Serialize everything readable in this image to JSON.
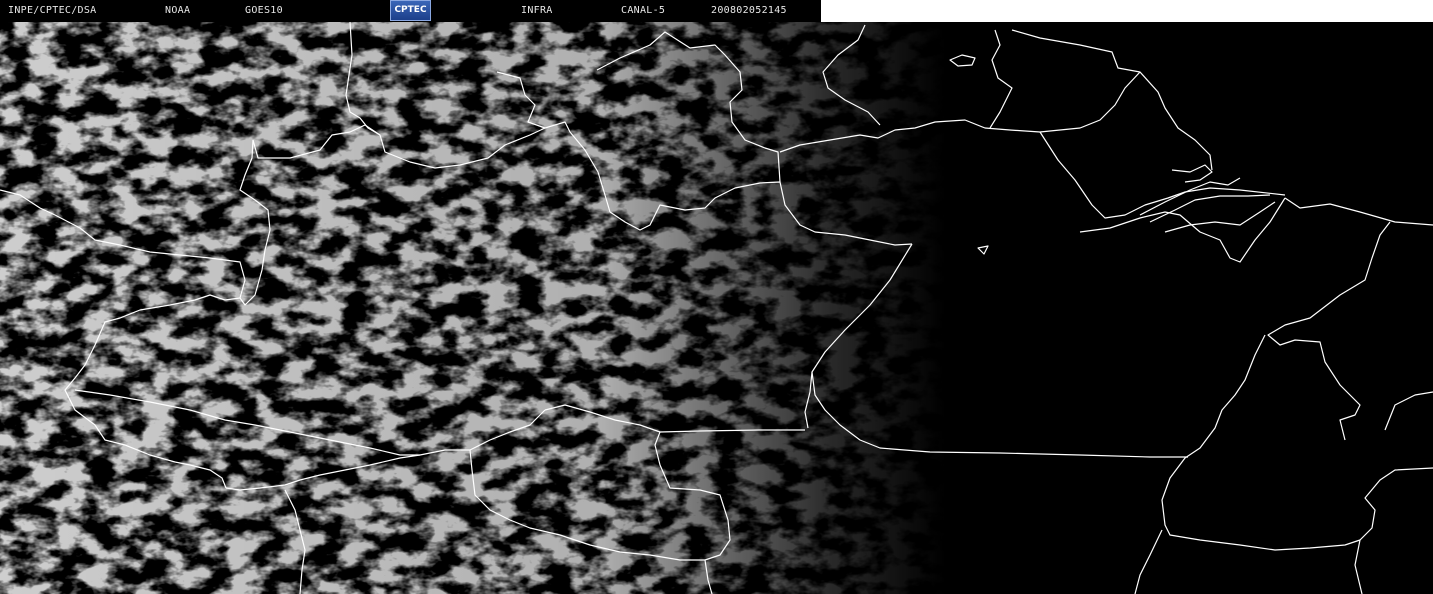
{
  "header": {
    "institution": "INPE/CPTEC/DSA",
    "agency": "NOAA",
    "satellite": "GOES10",
    "logo_text": "CPTEC",
    "product": "INFRA",
    "channel": "CANAL-5",
    "timestamp": "200802052145"
  },
  "colors": {
    "background": "#000000",
    "header_text": "#e8e8e8",
    "borders": "#ffffff",
    "clouds": "#9a9a9a",
    "logo": "#2a56a8"
  },
  "map": {
    "type": "infrared satellite image",
    "overlay": "political boundaries",
    "cloud_cover_region": "west"
  }
}
